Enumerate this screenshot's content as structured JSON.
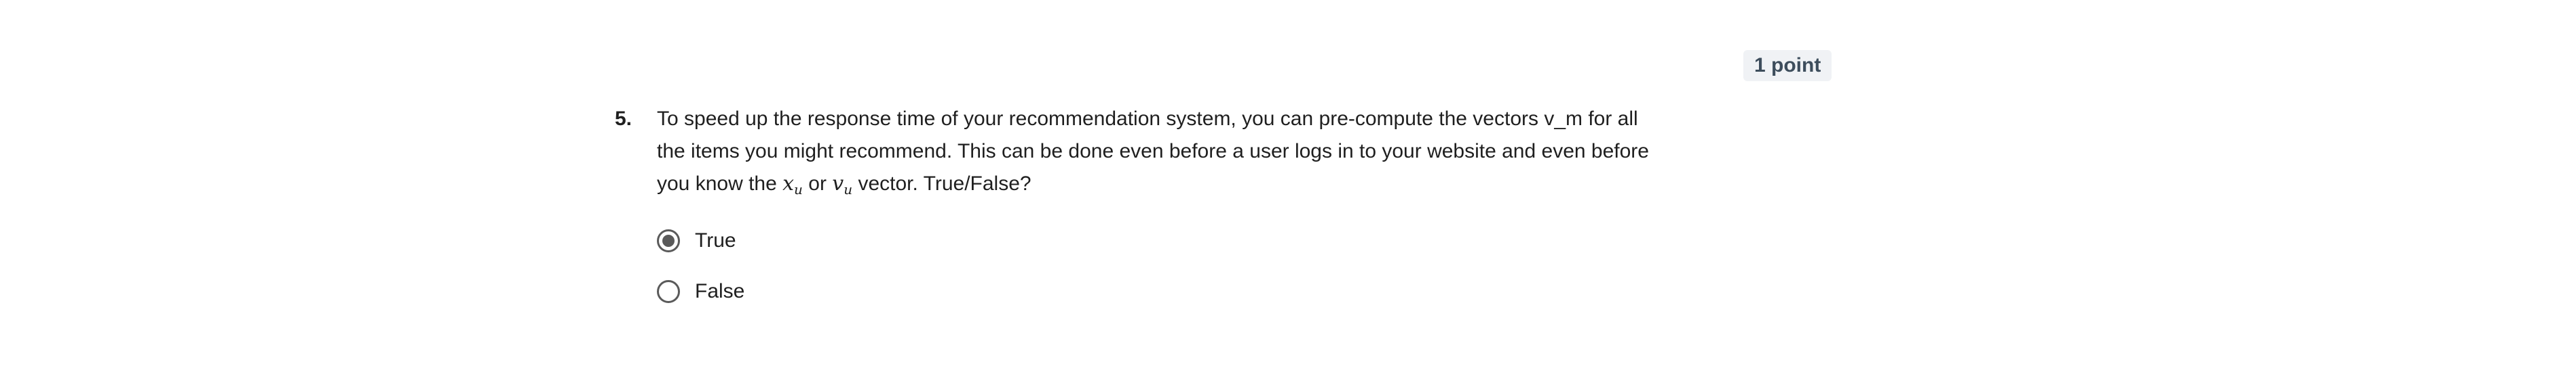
{
  "points": "1 point",
  "question": {
    "number": "5.",
    "text_part1": "To speed up the response time of your recommendation system, you can pre-compute the vectors v_m for all the items you might recommend. This can be done even before a user logs in to your website and even before you know the ",
    "math1_base": "x",
    "math1_sub": "u",
    "text_part2": " or ",
    "math2_base": "v",
    "math2_sub": "u",
    "text_part3": " vector. True/False?"
  },
  "options": [
    {
      "label": "True",
      "selected": true
    },
    {
      "label": "False",
      "selected": false
    }
  ]
}
